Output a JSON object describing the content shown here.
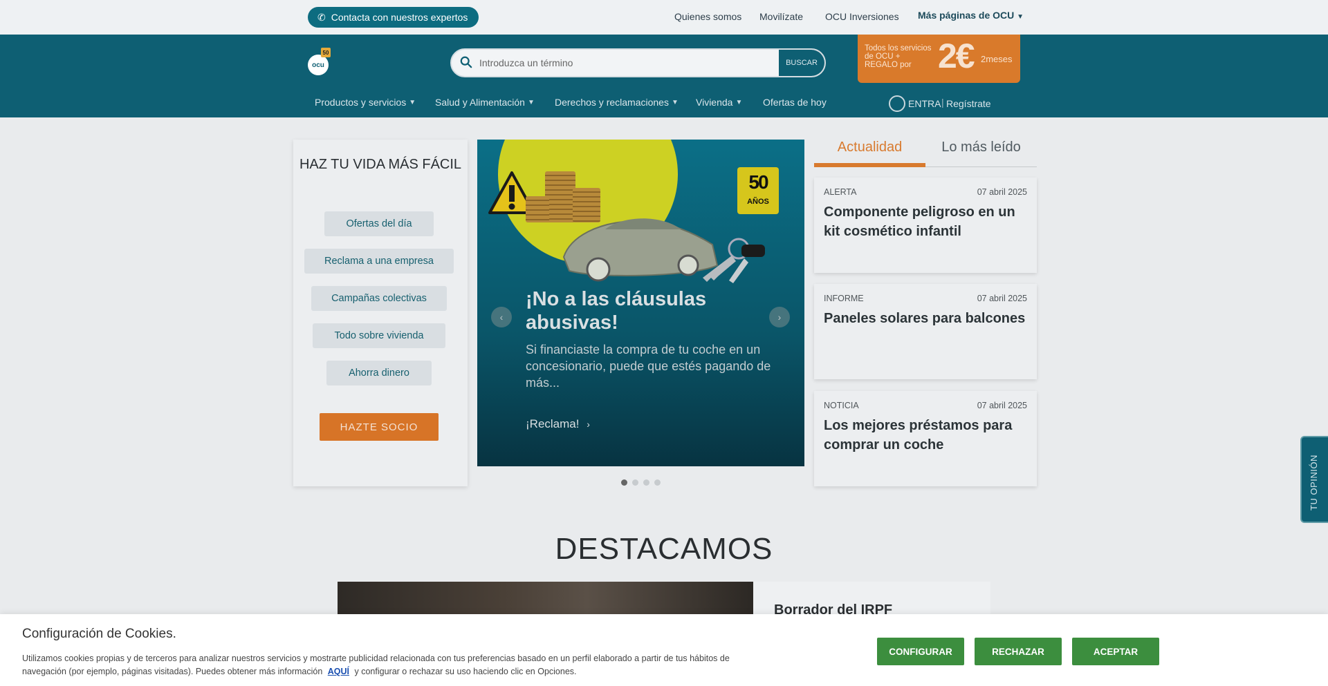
{
  "topbar": {
    "contact_label": "Contacta con nuestros expertos",
    "links": [
      "Quienes somos",
      "Movilízate",
      "OCU Inversiones"
    ],
    "more_label": "Más páginas de OCU"
  },
  "header": {
    "logo_text": "ocu",
    "search_placeholder": "Introduzca un término",
    "search_button": "BUSCAR",
    "promo": {
      "text": "Todos los servicios de OCU + REGALO por",
      "price": "2€",
      "period": "2meses"
    },
    "nav": [
      "Productos y servicios",
      "Salud y Alimentación",
      "Derechos y reclamaciones",
      "Vivienda",
      "Ofertas de hoy"
    ],
    "login_label": "ENTRA",
    "separator": "|",
    "register_label": "Regístrate"
  },
  "left_panel": {
    "title": "HAZ TU VIDA MÁS FÁCIL",
    "links": [
      "Ofertas del día",
      "Reclama a una empresa",
      "Campañas colectivas",
      "Todo sobre vivienda",
      "Ahorra dinero"
    ],
    "cta": "HAZTE SOCIO"
  },
  "carousel": {
    "badge_number": "50",
    "badge_label": "AÑOS",
    "title": "¡No a las cláusulas abusivas!",
    "text": "Si financiaste la compra de tu coche en un concesionario, puede que estés pagando de más...",
    "link": "¡Reclama!",
    "prev_icon": "‹",
    "next_icon": "›",
    "slides": 4,
    "active_slide": 1
  },
  "news": {
    "tabs": [
      "Actualidad",
      "Lo más leído"
    ],
    "items": [
      {
        "category": "ALERTA",
        "date": "07 abril 2025",
        "title": "Componente peligroso en un kit cosmético infantil"
      },
      {
        "category": "INFORME",
        "date": "07 abril 2025",
        "title": "Paneles solares para balcones"
      },
      {
        "category": "NOTICIA",
        "date": "07 abril 2025",
        "title": "Los mejores préstamos para comprar un coche"
      }
    ]
  },
  "featured": {
    "heading": "DESTACAMOS",
    "title": "Borrador del IRPF"
  },
  "opinion_tab": "TU OPINIÓN",
  "cookies": {
    "title": "Configuración de Cookies.",
    "text_before": "Utilizamos cookies propias y de terceros para analizar nuestros servicios y mostrarte publicidad relacionada con tus preferencias basado en un perfil elaborado a partir de tus hábitos de navegación (por ejemplo, páginas visitadas). Puedes obtener más información",
    "link": "AQUÍ",
    "text_after": "y configurar o rechazar su uso haciendo clic en Opciones.",
    "buttons": [
      "CONFIGURAR",
      "RECHAZAR",
      "ACEPTAR"
    ]
  },
  "colors": {
    "brand_teal": "#0e5f73",
    "accent_orange": "#d97a2b",
    "accept_green": "#3c8e3e"
  }
}
